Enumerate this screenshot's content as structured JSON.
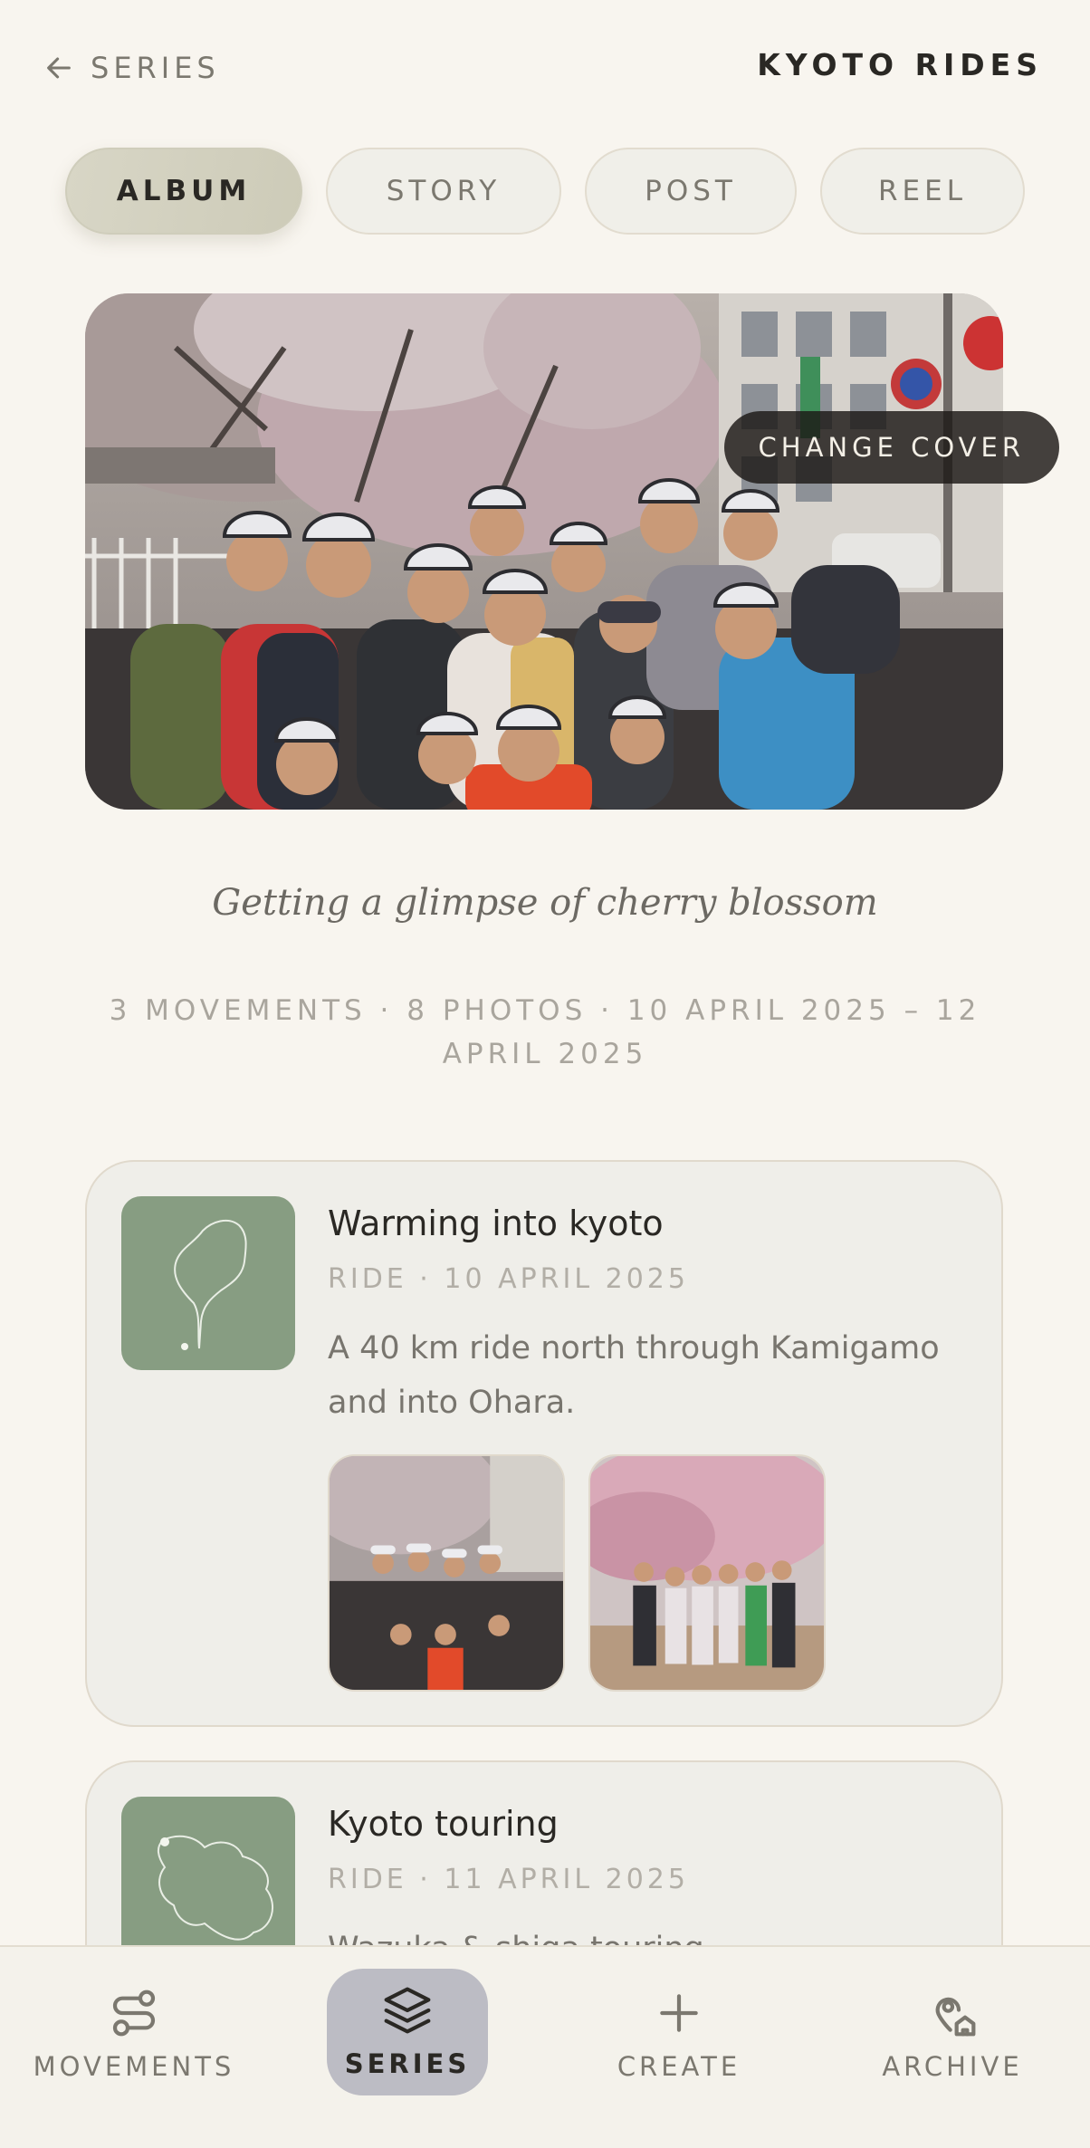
{
  "header": {
    "back_label": "SERIES",
    "title": "KYOTO RIDES"
  },
  "tabs": [
    {
      "label": "ALBUM",
      "active": true
    },
    {
      "label": "STORY",
      "active": false
    },
    {
      "label": "POST",
      "active": false
    },
    {
      "label": "REEL",
      "active": false
    }
  ],
  "cover": {
    "change_label": "CHANGE COVER"
  },
  "series": {
    "subtitle": "Getting a glimpse of cherry blossom",
    "meta": "3 MOVEMENTS · 8 PHOTOS · 10 APRIL 2025 – 12 APRIL 2025"
  },
  "movements": [
    {
      "title": "Warming into kyoto",
      "meta": "RIDE · 10 APRIL 2025",
      "description": "A 40 km ride north through Kamigamo and into Ohara."
    },
    {
      "title": "Kyoto touring",
      "meta": "RIDE · 11 APRIL 2025",
      "description": "Wazuka & shiga touring"
    }
  ],
  "nav": [
    {
      "label": "MOVEMENTS",
      "icon": "route-icon",
      "active": false
    },
    {
      "label": "SERIES",
      "icon": "layers-icon",
      "active": true
    },
    {
      "label": "CREATE",
      "icon": "plus-icon",
      "active": false
    },
    {
      "label": "ARCHIVE",
      "icon": "map-pin-home-icon",
      "active": false
    }
  ],
  "colors": {
    "background": "#f8f5ef",
    "active_tab": "#d3d1bf",
    "active_nav": "#bcbcc4",
    "map_green": "#879d82"
  }
}
